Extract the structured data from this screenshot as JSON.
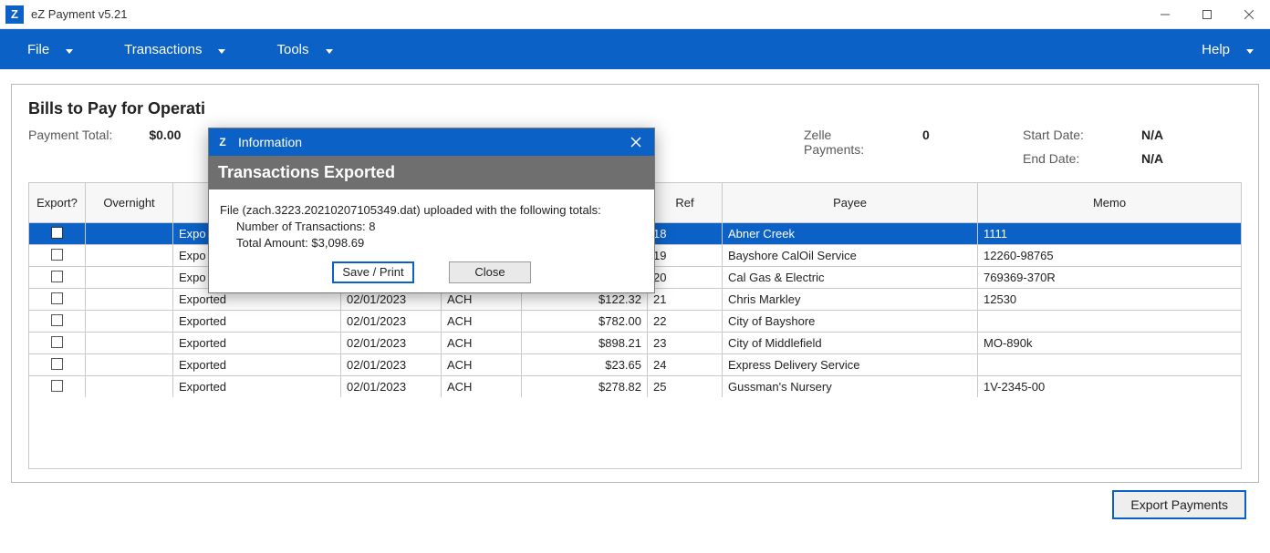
{
  "window": {
    "title": "eZ Payment v5.21",
    "app_icon_letter": "Z"
  },
  "menubar": {
    "file": "File",
    "transactions": "Transactions",
    "tools": "Tools",
    "help": "Help"
  },
  "panel": {
    "title": "Bills to Pay for Operati",
    "payment_total_label": "Payment Total:",
    "payment_total_value": "$0.00",
    "zelle_label": "Zelle Payments:",
    "zelle_value": "0",
    "start_date_label": "Start Date:",
    "start_date_value": "N/A",
    "end_date_label": "End Date:",
    "end_date_value": "N/A"
  },
  "columns": {
    "export": "Export?",
    "overnight": "Overnight",
    "status": "",
    "date": "",
    "method": "",
    "amount": "",
    "ref": "Ref",
    "payee": "Payee",
    "memo": "Memo"
  },
  "rows": [
    {
      "status": "Expo",
      "date": "",
      "method": "",
      "amount": "",
      "ref": "18",
      "payee": "Abner Creek",
      "memo": "1111",
      "selected": true
    },
    {
      "status": "Expo",
      "date": "",
      "method": "",
      "amount": "",
      "ref": "19",
      "payee": "Bayshore CalOil Service",
      "memo": "12260-98765",
      "selected": false
    },
    {
      "status": "Expo",
      "date": "",
      "method": "",
      "amount": "",
      "ref": "20",
      "payee": "Cal Gas & Electric",
      "memo": "769369-370R",
      "selected": false
    },
    {
      "status": "Exported",
      "date": "02/01/2023",
      "method": "ACH",
      "amount": "$122.32",
      "ref": "21",
      "payee": "Chris Markley",
      "memo": "12530",
      "selected": false
    },
    {
      "status": "Exported",
      "date": "02/01/2023",
      "method": "ACH",
      "amount": "$782.00",
      "ref": "22",
      "payee": "City of Bayshore",
      "memo": "",
      "selected": false
    },
    {
      "status": "Exported",
      "date": "02/01/2023",
      "method": "ACH",
      "amount": "$898.21",
      "ref": "23",
      "payee": "City of Middlefield",
      "memo": "MO-890k",
      "selected": false
    },
    {
      "status": "Exported",
      "date": "02/01/2023",
      "method": "ACH",
      "amount": "$23.65",
      "ref": "24",
      "payee": "Express Delivery Service",
      "memo": "",
      "selected": false
    },
    {
      "status": "Exported",
      "date": "02/01/2023",
      "method": "ACH",
      "amount": "$278.82",
      "ref": "25",
      "payee": "Gussman's Nursery",
      "memo": "1V-2345-00",
      "selected": false
    }
  ],
  "footer": {
    "export_btn": "Export Payments"
  },
  "modal": {
    "title": "Information",
    "header": "Transactions Exported",
    "line1": "File (zach.3223.20210207105349.dat) uploaded with the following totals:",
    "line2": "Number of Transactions: 8",
    "line3": "Total Amount: $3,098.69",
    "save_print": "Save / Print",
    "close": "Close"
  }
}
